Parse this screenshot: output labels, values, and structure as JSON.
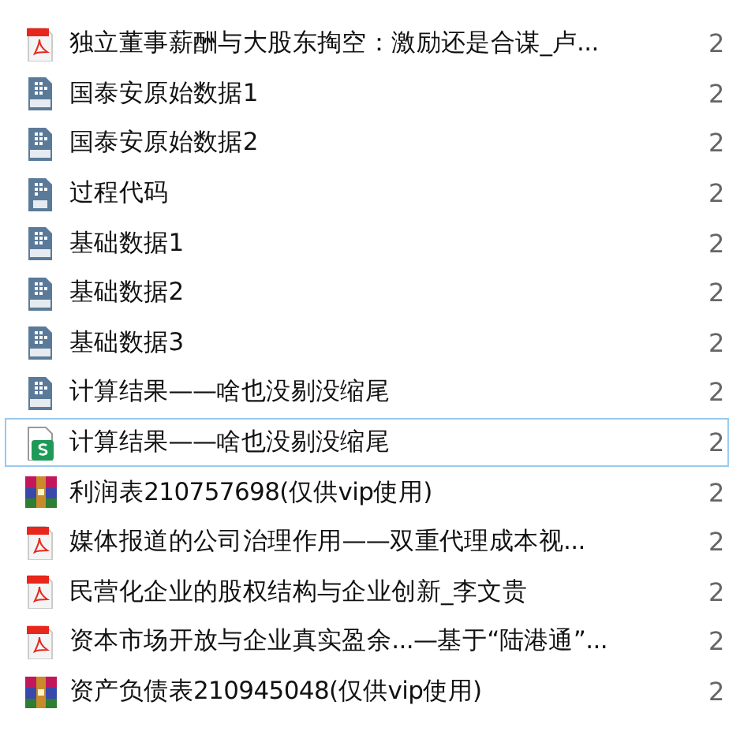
{
  "files": [
    {
      "kind": "pdf",
      "name": "独立董事薪酬与大股东掏空：激励还是合谋_卢...",
      "date": "2",
      "focused": false
    },
    {
      "kind": "dta",
      "name": "国泰安原始数据1",
      "date": "2",
      "focused": false
    },
    {
      "kind": "dta",
      "name": "国泰安原始数据2",
      "date": "2",
      "focused": false
    },
    {
      "kind": "do",
      "name": "过程代码",
      "date": "2",
      "focused": false
    },
    {
      "kind": "dta",
      "name": "基础数据1",
      "date": "2",
      "focused": false
    },
    {
      "kind": "dta",
      "name": "基础数据2",
      "date": "2",
      "focused": false
    },
    {
      "kind": "dta",
      "name": "基础数据3",
      "date": "2",
      "focused": false
    },
    {
      "kind": "dta",
      "name": "计算结果——啥也没剔没缩尾",
      "date": "2",
      "focused": false
    },
    {
      "kind": "sheet",
      "name": "计算结果——啥也没剔没缩尾",
      "date": "2",
      "focused": true
    },
    {
      "kind": "rar",
      "name": "利润表210757698(仅供vip使用)",
      "date": "2",
      "focused": false
    },
    {
      "kind": "pdf",
      "name": "媒体报道的公司治理作用——双重代理成本视...",
      "date": "2",
      "focused": false
    },
    {
      "kind": "pdf",
      "name": "民营化企业的股权结构与企业创新_李文贵",
      "date": "2",
      "focused": false
    },
    {
      "kind": "pdf",
      "name": "资本市场开放与企业真实盈余...—基于“陆港通”...",
      "date": "2",
      "focused": false
    },
    {
      "kind": "rar",
      "name": "资产负债表210945048(仅供vip使用)",
      "date": "2",
      "focused": false
    }
  ]
}
